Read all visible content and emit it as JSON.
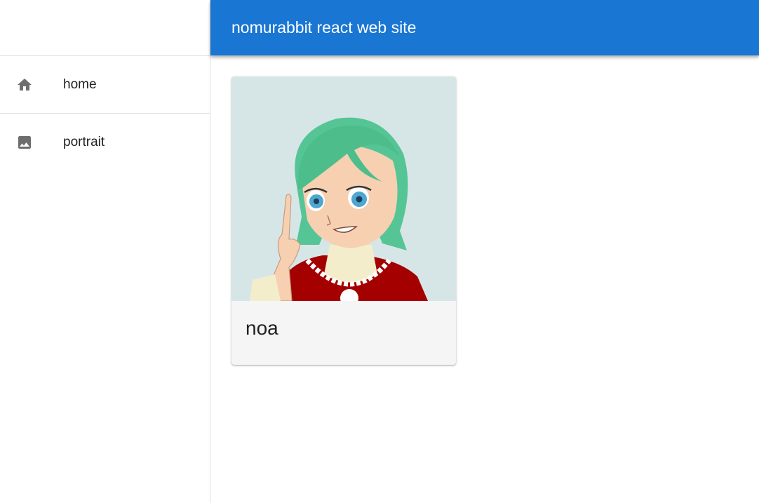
{
  "appbar": {
    "title": "nomurabbit react web site",
    "color": "#1976d2"
  },
  "sidebar": {
    "items": [
      {
        "label": "home",
        "icon": "home-icon"
      },
      {
        "label": "portrait",
        "icon": "image-icon"
      }
    ]
  },
  "cards": [
    {
      "title": "noa",
      "image": "anime-girl-portrait"
    }
  ]
}
